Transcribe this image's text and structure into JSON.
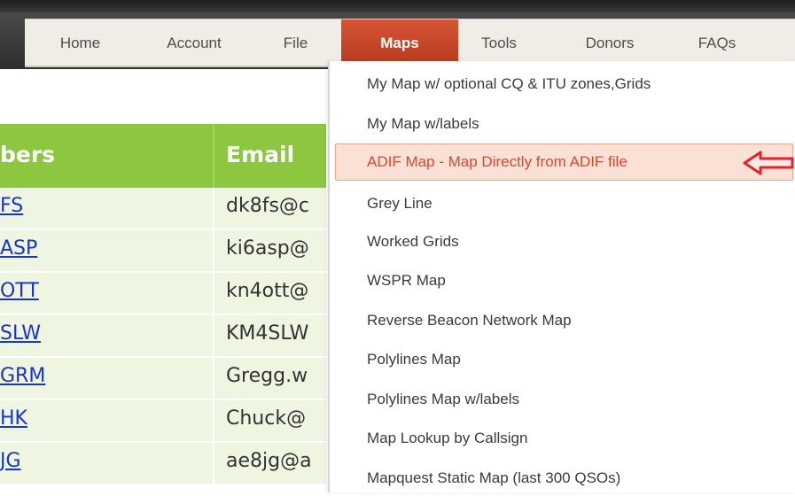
{
  "nav": {
    "items": [
      {
        "label": "Home"
      },
      {
        "label": "Account"
      },
      {
        "label": "File"
      },
      {
        "label": "Maps"
      },
      {
        "label": "Tools"
      },
      {
        "label": "Donors"
      },
      {
        "label": "FAQs"
      }
    ],
    "active": "Maps"
  },
  "table": {
    "headers": [
      "bers",
      "Email"
    ],
    "rows": [
      {
        "call": "FS",
        "email": "dk8fs@c"
      },
      {
        "call": "ASP",
        "email": "ki6asp@"
      },
      {
        "call": "OTT",
        "email": "kn4ott@"
      },
      {
        "call": "SLW",
        "email": "KM4SLW"
      },
      {
        "call": "GRM",
        "email": "Gregg.w"
      },
      {
        "call": "HK",
        "email": "Chuck@"
      },
      {
        "call": "JG",
        "email": "ae8jg@a"
      }
    ]
  },
  "maps_menu": {
    "items": [
      "My Map w/ optional CQ & ITU zones,Grids",
      "My Map w/labels",
      "ADIF Map - Map Directly from ADIF file",
      "Grey Line",
      "Worked Grids",
      "WSPR Map",
      "Reverse Beacon Network Map",
      "Polylines Map",
      "Polylines Map w/labels",
      "Map Lookup by Callsign",
      "Mapquest Static Map (last 300 QSOs)"
    ],
    "highlighted": "ADIF Map - Map Directly from ADIF file"
  },
  "colors": {
    "nav_active": "#c44a2a",
    "table_header": "#8dc63f",
    "table_row": "#eef6e1",
    "highlight_bg": "#fbe0d5",
    "highlight_text": "#d9492c",
    "arrow": "#e8202a"
  },
  "icons": {
    "pointer_arrow": "left-arrow-icon"
  }
}
